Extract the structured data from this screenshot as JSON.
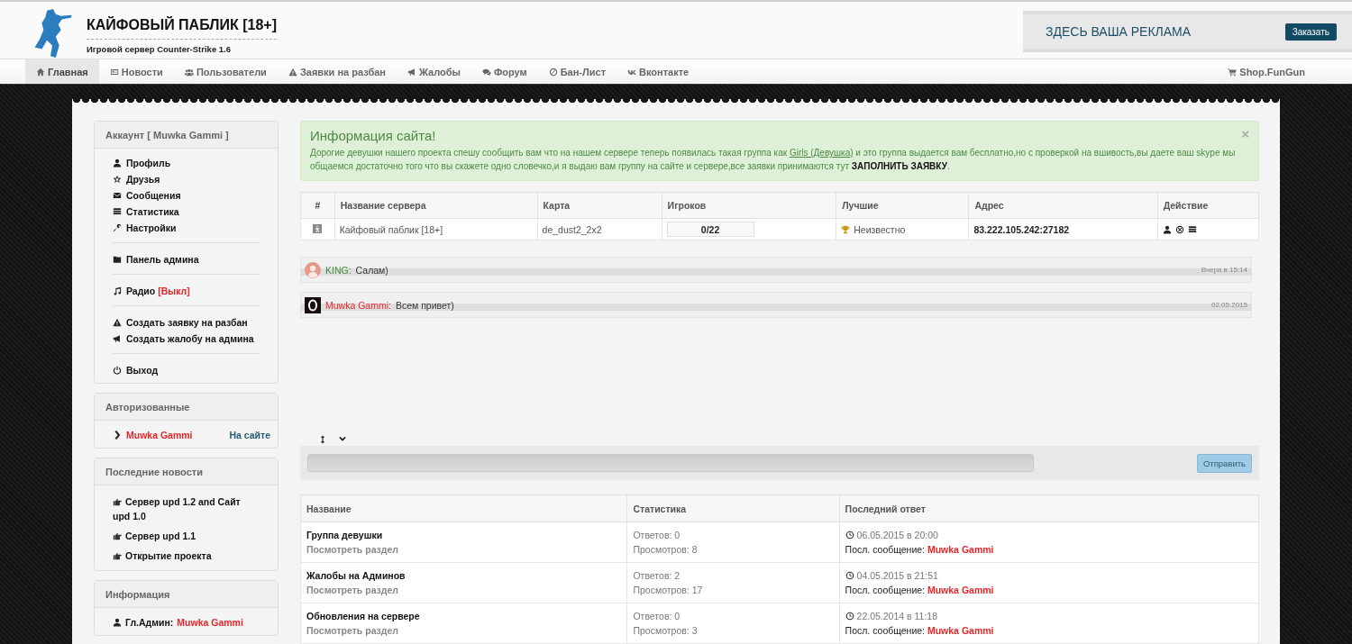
{
  "header": {
    "title": "КАЙФОВЫЙ ПАБЛИК [18+]",
    "subtitle": "Игровой сервер Counter-Strike 1.6",
    "ad": {
      "text": "ЗДЕСЬ ВАША РЕКЛАМА",
      "button": "Заказать"
    }
  },
  "nav": {
    "items": [
      {
        "label": "Главная",
        "selected": true
      },
      {
        "label": "Новости",
        "selected": false
      },
      {
        "label": "Пользователи",
        "selected": false
      },
      {
        "label": "Заявки на разбан",
        "selected": false
      },
      {
        "label": "Жалобы",
        "selected": false
      },
      {
        "label": "Форум",
        "selected": false
      },
      {
        "label": "Бан-Лист",
        "selected": false
      },
      {
        "label": "Вконтакте",
        "selected": false
      }
    ],
    "right": {
      "label": "Shop.FunGun"
    }
  },
  "account": {
    "title": "Аккаунт [ Muwka Gammi ]",
    "groups": [
      [
        {
          "label": "Профиль"
        },
        {
          "label": "Друзья"
        },
        {
          "label": "Сообщения"
        },
        {
          "label": "Статистика"
        },
        {
          "label": "Настройки"
        }
      ],
      [
        {
          "label": "Панель админа"
        }
      ],
      [
        {
          "label": "Радио",
          "status": "[Выкл]"
        }
      ],
      [
        {
          "label": "Создать заявку на разбан"
        },
        {
          "label": "Создать жалобу на админа"
        }
      ],
      [
        {
          "label": "Выход"
        }
      ]
    ]
  },
  "online": {
    "title": "Авторизованные",
    "users": [
      {
        "name": "Muwka Gammi",
        "status": "На сайте"
      }
    ]
  },
  "news": {
    "title": "Последние новости",
    "items": [
      "Сервер upd 1.2 and Сайт upd 1.0",
      "Сервер upd 1.1",
      "Открытие проекта"
    ]
  },
  "info": {
    "title": "Информация",
    "items": [
      {
        "label": "Гл.Админ:",
        "value": "Muwka Gammi"
      }
    ]
  },
  "alert": {
    "title": "Информация сайта!",
    "close": "×",
    "text_before": "Дорогие девушки нашего проекта спешу сообщить вам что на нашем сервере теперь появилась такая группа как",
    "link": "Girls (Девушка)",
    "text_after": "и это группа выдается вам бесплатно,но с проверкой на вшивость,вы даете ваш skype мы общаемся достаточно того что вы скажете одно словечко,и я выдаю вам группу на сайте и сервере,все заявки принимаются тут **ЗАПОЛНИТЬ ЗАЯВКУ**."
  },
  "servers": {
    "columns": [
      "#",
      "Название сервера",
      "Карта",
      "Игроков",
      "Лучшие",
      "Адрес",
      "Действие"
    ],
    "rows": [
      {
        "name": "Кайфовый паблик [18+]",
        "map": "de_dust2_2x2",
        "players": "0/22",
        "best": "Неизвестно",
        "address": "83.222.105.242:27182"
      }
    ]
  },
  "chat": {
    "messages": [
      {
        "user": "KING:",
        "color": "#3a8a3a",
        "text": "Салам)",
        "time": "Вчера в 15:14"
      },
      {
        "user": "Muwka Gammi:",
        "color": "#e8262a",
        "text": "Всем привет)",
        "time": "02.05.2015"
      }
    ],
    "send": "Отправить"
  },
  "forum": {
    "columns": [
      "Название",
      "Статистика",
      "Последний ответ"
    ],
    "rows": [
      {
        "title": "Группа девушки",
        "sub": "Посмотреть раздел",
        "answers": "Ответов: 0",
        "views": "Просмотров: 8",
        "date": "06.05.2015 в 20:00",
        "last_label": "Посл. сообщение:",
        "last_user": "Muwka Gammi"
      },
      {
        "title": "Жалобы на Админов",
        "sub": "Посмотреть раздел",
        "answers": "Ответов: 2",
        "views": "Просмотров: 17",
        "date": "04.05.2015 в 21:51",
        "last_label": "Посл. сообщение:",
        "last_user": "Muwka Gammi"
      },
      {
        "title": "Обновления на сервере",
        "sub": "Посмотреть раздел",
        "answers": "Ответов: 0",
        "views": "Просмотров: 3",
        "date": "22.05.2014 в 11:18",
        "last_label": "Посл. сообщение:",
        "last_user": "Muwka Gammi"
      }
    ]
  }
}
